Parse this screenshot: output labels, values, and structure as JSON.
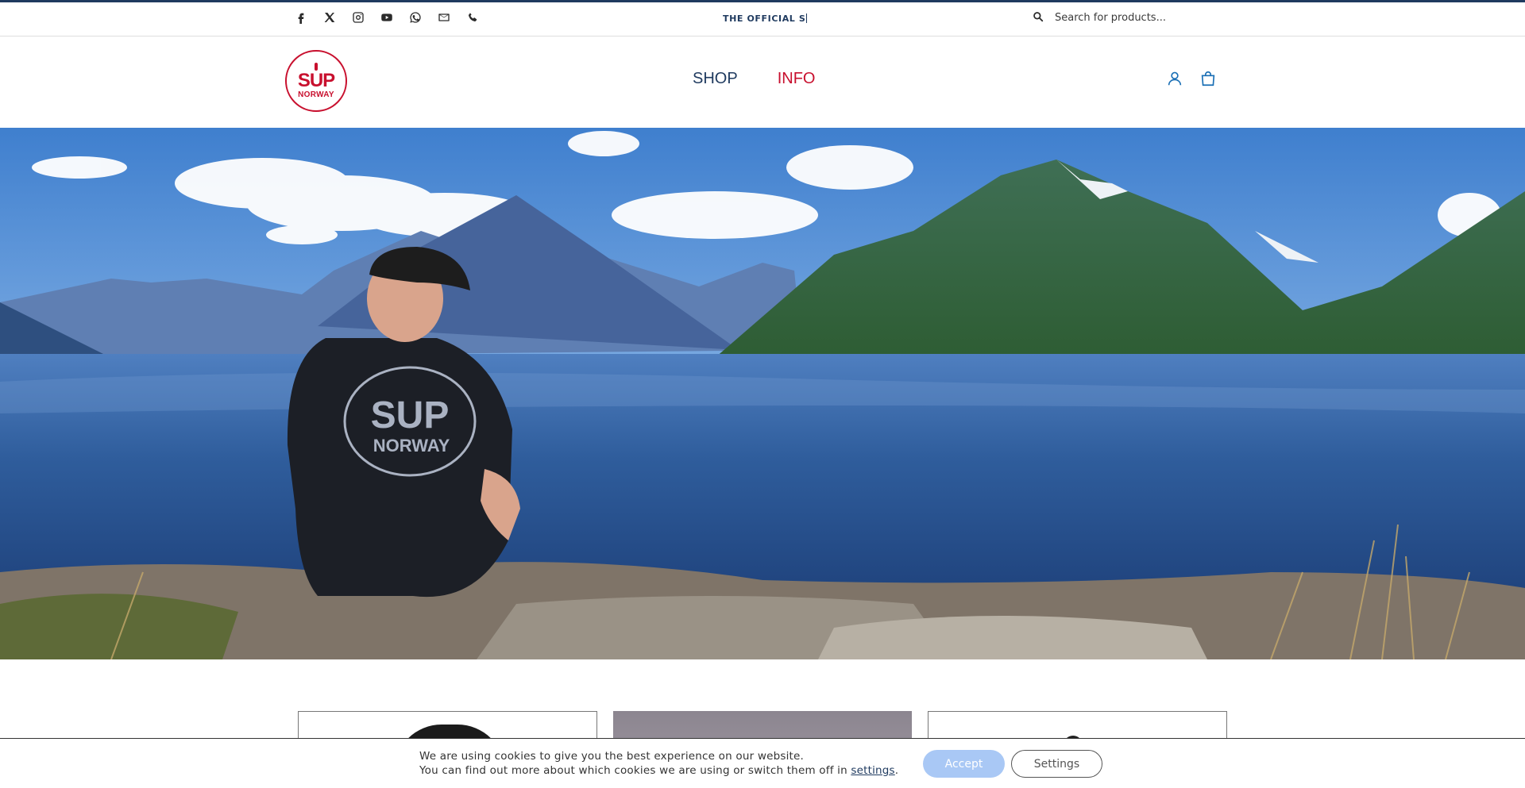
{
  "topbar": {
    "social_icons": [
      "facebook-icon",
      "x-icon",
      "instagram-icon",
      "youtube-icon",
      "whatsapp-icon",
      "email-icon",
      "phone-icon"
    ],
    "ticker_text": "THE OFFICIAL S",
    "search_placeholder": "Search for products..."
  },
  "header": {
    "logo_line1": "SUP",
    "logo_line2": "NORWAY",
    "nav": {
      "shop": "SHOP",
      "info": "INFO"
    },
    "icons": [
      "user-icon",
      "shopping-bag-icon"
    ]
  },
  "hero": {
    "shirt_line1": "SUP",
    "shirt_line2": "NORWAY"
  },
  "cookie": {
    "line1": "We are using cookies to give you the best experience on our website.",
    "line2_prefix": "You can find out more about which cookies we are using or switch them off in ",
    "line2_link": "settings",
    "line2_suffix": ".",
    "accept_label": "Accept",
    "settings_label": "Settings"
  },
  "colors": {
    "brand_navy": "#1f3a5f",
    "brand_red": "#c8102e",
    "icon_blue": "#1a6fb5",
    "accept_button": "#a9c8f5"
  }
}
